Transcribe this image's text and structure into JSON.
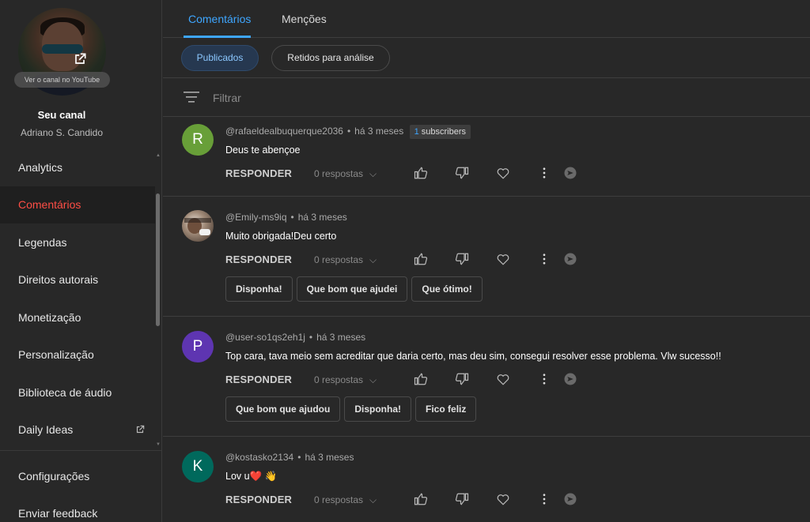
{
  "sidebar": {
    "view_channel_label": "Ver o canal no YouTube",
    "channel_title": "Seu canal",
    "channel_name": "Adriano S. Candido",
    "items": [
      {
        "label": "Analytics",
        "active": false
      },
      {
        "label": "Comentários",
        "active": true
      },
      {
        "label": "Legendas",
        "active": false
      },
      {
        "label": "Direitos autorais",
        "active": false
      },
      {
        "label": "Monetização",
        "active": false
      },
      {
        "label": "Personalização",
        "active": false
      },
      {
        "label": "Biblioteca de áudio",
        "active": false
      },
      {
        "label": "Daily Ideas",
        "active": false,
        "external": true
      }
    ],
    "bottom_items": [
      {
        "label": "Configurações"
      },
      {
        "label": "Enviar feedback"
      }
    ]
  },
  "tabs": [
    {
      "label": "Comentários",
      "active": true
    },
    {
      "label": "Menções",
      "active": false
    }
  ],
  "chips": [
    {
      "label": "Publicados",
      "active": true
    },
    {
      "label": "Retidos para análise",
      "active": false
    }
  ],
  "filter": {
    "placeholder": "Filtrar",
    "icon": "filter-icon"
  },
  "comments": [
    {
      "author": "@rafaeldealbuquerque2036",
      "time": "há 3 meses",
      "badge_count": "1",
      "badge_label": "subscribers",
      "avatar_letter": "R",
      "avatar_color": "#689f38",
      "text": "Deus te abençoe",
      "reply_label": "RESPONDER",
      "replies_label": "0 respostas",
      "suggestions": []
    },
    {
      "author": "@Emily-ms9iq",
      "time": "há 3 meses",
      "avatar_letter": "",
      "avatar_color": "#5b4a3e",
      "text": "Muito obrigada!Deu certo",
      "reply_label": "RESPONDER",
      "replies_label": "0 respostas",
      "suggestions": [
        "Disponha!",
        "Que bom que ajudei",
        "Que ótimo!"
      ]
    },
    {
      "author": "@user-so1qs2eh1j",
      "time": "há 3 meses",
      "avatar_letter": "P",
      "avatar_color": "#5e35b1",
      "text": "Top cara, tava meio sem acreditar que daria certo, mas deu sim, consegui resolver esse problema. Vlw sucesso!!",
      "reply_label": "RESPONDER",
      "replies_label": "0 respostas",
      "suggestions": [
        "Que bom que ajudou",
        "Disponha!",
        "Fico feliz"
      ]
    },
    {
      "author": "@kostasko2134",
      "time": "há 3 meses",
      "avatar_letter": "K",
      "avatar_color": "#00695c",
      "text": "Lov u❤️ 👋",
      "reply_label": "RESPONDER",
      "replies_label": "0 respostas",
      "suggestions": []
    }
  ],
  "colors": {
    "accent": "#3ea6ff",
    "active_nav": "#ff4e45",
    "background": "#282828"
  }
}
